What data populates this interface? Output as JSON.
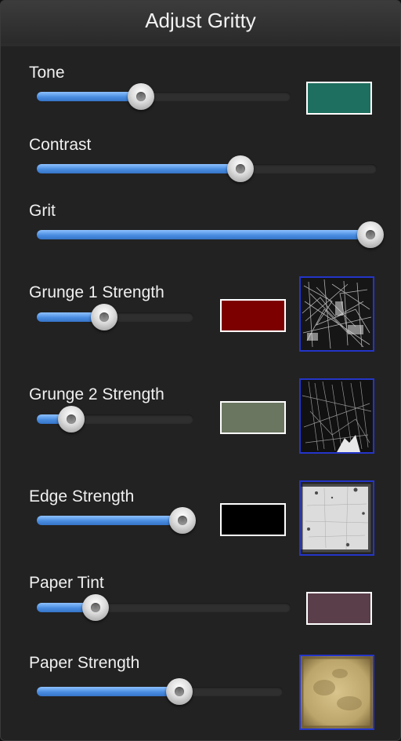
{
  "title": "Adjust Gritty",
  "controls": {
    "tone": {
      "label": "Tone",
      "value": 0.41,
      "color": "#1e6f5f"
    },
    "contrast": {
      "label": "Contrast",
      "value": 0.6
    },
    "grit": {
      "label": "Grit",
      "value": 1.0
    },
    "grunge1": {
      "label": "Grunge 1 Strength",
      "value": 0.43,
      "color": "#7d0000",
      "texture": "dark-scratch-texture"
    },
    "grunge2": {
      "label": "Grunge 2 Strength",
      "value": 0.22,
      "color": "#6b7660",
      "texture": "dark-streak-texture"
    },
    "edge": {
      "label": "Edge Strength",
      "value": 0.93,
      "color": "#000000",
      "texture": "white-edge-texture"
    },
    "paper_tint": {
      "label": "Paper Tint",
      "value": 0.23,
      "color": "#5a3e4a"
    },
    "paper_strength": {
      "label": "Paper Strength",
      "value": 0.58,
      "texture": "parchment-texture"
    }
  },
  "colors": {
    "accent": "#4a8de0",
    "texture_border": "#2435c8"
  }
}
